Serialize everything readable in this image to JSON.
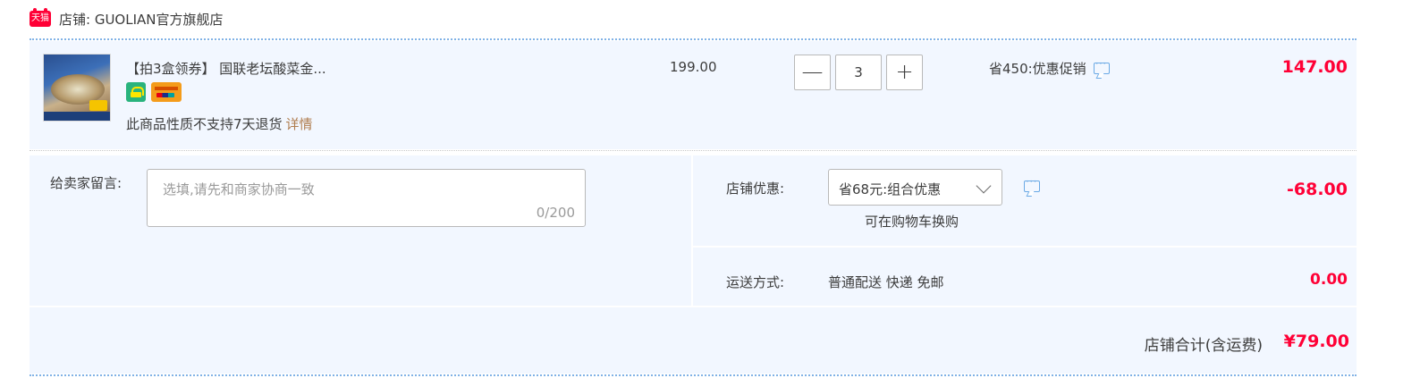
{
  "shop": {
    "badge_text": "天猫",
    "name": "店铺: GUOLIAN官方旗舰店"
  },
  "item": {
    "title": "【拍3盒领券】 国联老坛酸菜金...",
    "return_note": "此商品性质不支持7天退货",
    "detail_link": "详情",
    "unit_price": "199.00",
    "quantity": "3",
    "minus_label": "—",
    "plus_label": "+",
    "promo_text": "省450:优惠促销",
    "subtotal": "147.00"
  },
  "message": {
    "label": "给卖家留言:",
    "placeholder": "选填,请先和商家协商一致",
    "counter": "0/200"
  },
  "discount": {
    "label": "店铺优惠:",
    "selected": "省68元:组合优惠",
    "sub_note": "可在购物车换购",
    "amount": "-68.00"
  },
  "shipping": {
    "label": "运送方式:",
    "value": "普通配送 快递 免邮",
    "amount": "0.00"
  },
  "total": {
    "label": "店铺合计(含运费)",
    "amount": "¥79.00"
  },
  "colors": {
    "accent_red": "#ff0036",
    "panel_bg": "#f2f7ff",
    "link_brown": "#b07d4f",
    "icon_blue": "#6aa9e5"
  }
}
